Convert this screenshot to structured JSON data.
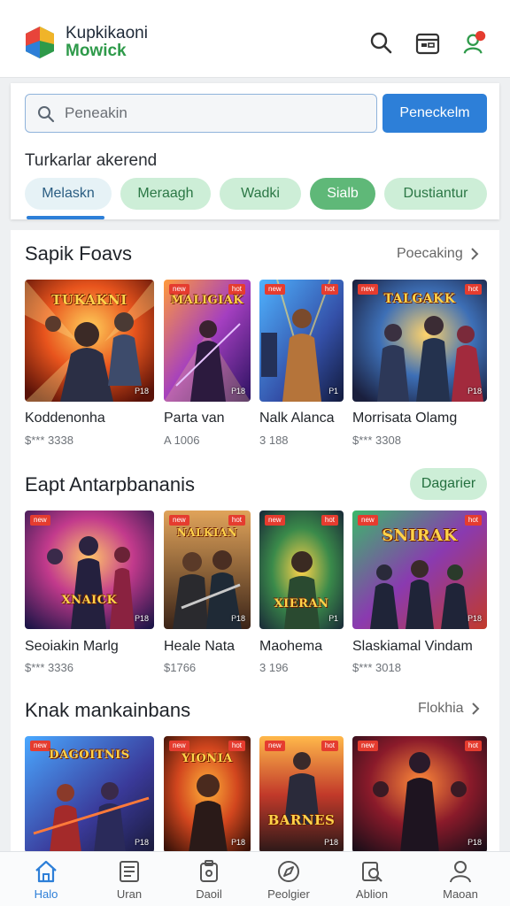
{
  "header": {
    "brand_line1": "Kupkikaoni",
    "brand_line2": "Mowick"
  },
  "search": {
    "placeholder": "Peneakin",
    "button_label": "Peneckelm"
  },
  "filters": {
    "label": "Turkarlar akerend",
    "chips": [
      "Melaskn",
      "Meraagh",
      "Wadki",
      "Sialb",
      "Dustiantur"
    ],
    "selected_index": 3
  },
  "sections": [
    {
      "title": "Sapik Foavs",
      "action": "Poecaking",
      "items": [
        {
          "name": "Koddenonha",
          "meta": "$*** 3338",
          "cover_title": "TUKAKNI"
        },
        {
          "name": "Parta van",
          "meta": "A 1006",
          "cover_title": "MALIGIAK"
        },
        {
          "name": "Nalk Alanca",
          "meta": "3 188",
          "cover_title": ""
        },
        {
          "name": "Morrisata Olamg",
          "meta": "$*** 3308",
          "cover_title": "TALGAKK"
        }
      ]
    },
    {
      "title": "Eapt Antarpbananis",
      "action": "Dagarier",
      "items": [
        {
          "name": "Seoiakin Marlg",
          "meta": "$*** 3336",
          "cover_title": "XNAICK"
        },
        {
          "name": "Heale Nata",
          "meta": "$1766",
          "cover_title": "NALKIAN"
        },
        {
          "name": "Maohema",
          "meta": "3 196",
          "cover_title": "XIERAN"
        },
        {
          "name": "Slaskiamal Vindam",
          "meta": "$*** 3018",
          "cover_title": "SNIRAK"
        }
      ]
    },
    {
      "title": "Knak mankainbans",
      "action": "Flokhia",
      "items": [
        {
          "name": "",
          "meta": "",
          "cover_title": "DAGOITNIS"
        },
        {
          "name": "",
          "meta": "",
          "cover_title": "YIONIA"
        },
        {
          "name": "",
          "meta": "",
          "cover_title": "BARNES"
        },
        {
          "name": "",
          "meta": "",
          "cover_title": ""
        }
      ]
    }
  ],
  "bottom_nav": [
    "Halo",
    "Uran",
    "Daoil",
    "Peolgier",
    "Ablion",
    "Maoan"
  ],
  "colors": {
    "accent": "#2d7fd8",
    "chip_bg": "#cdeed7",
    "chip_selected": "#5fb878",
    "brand_green": "#2e9a4a"
  }
}
